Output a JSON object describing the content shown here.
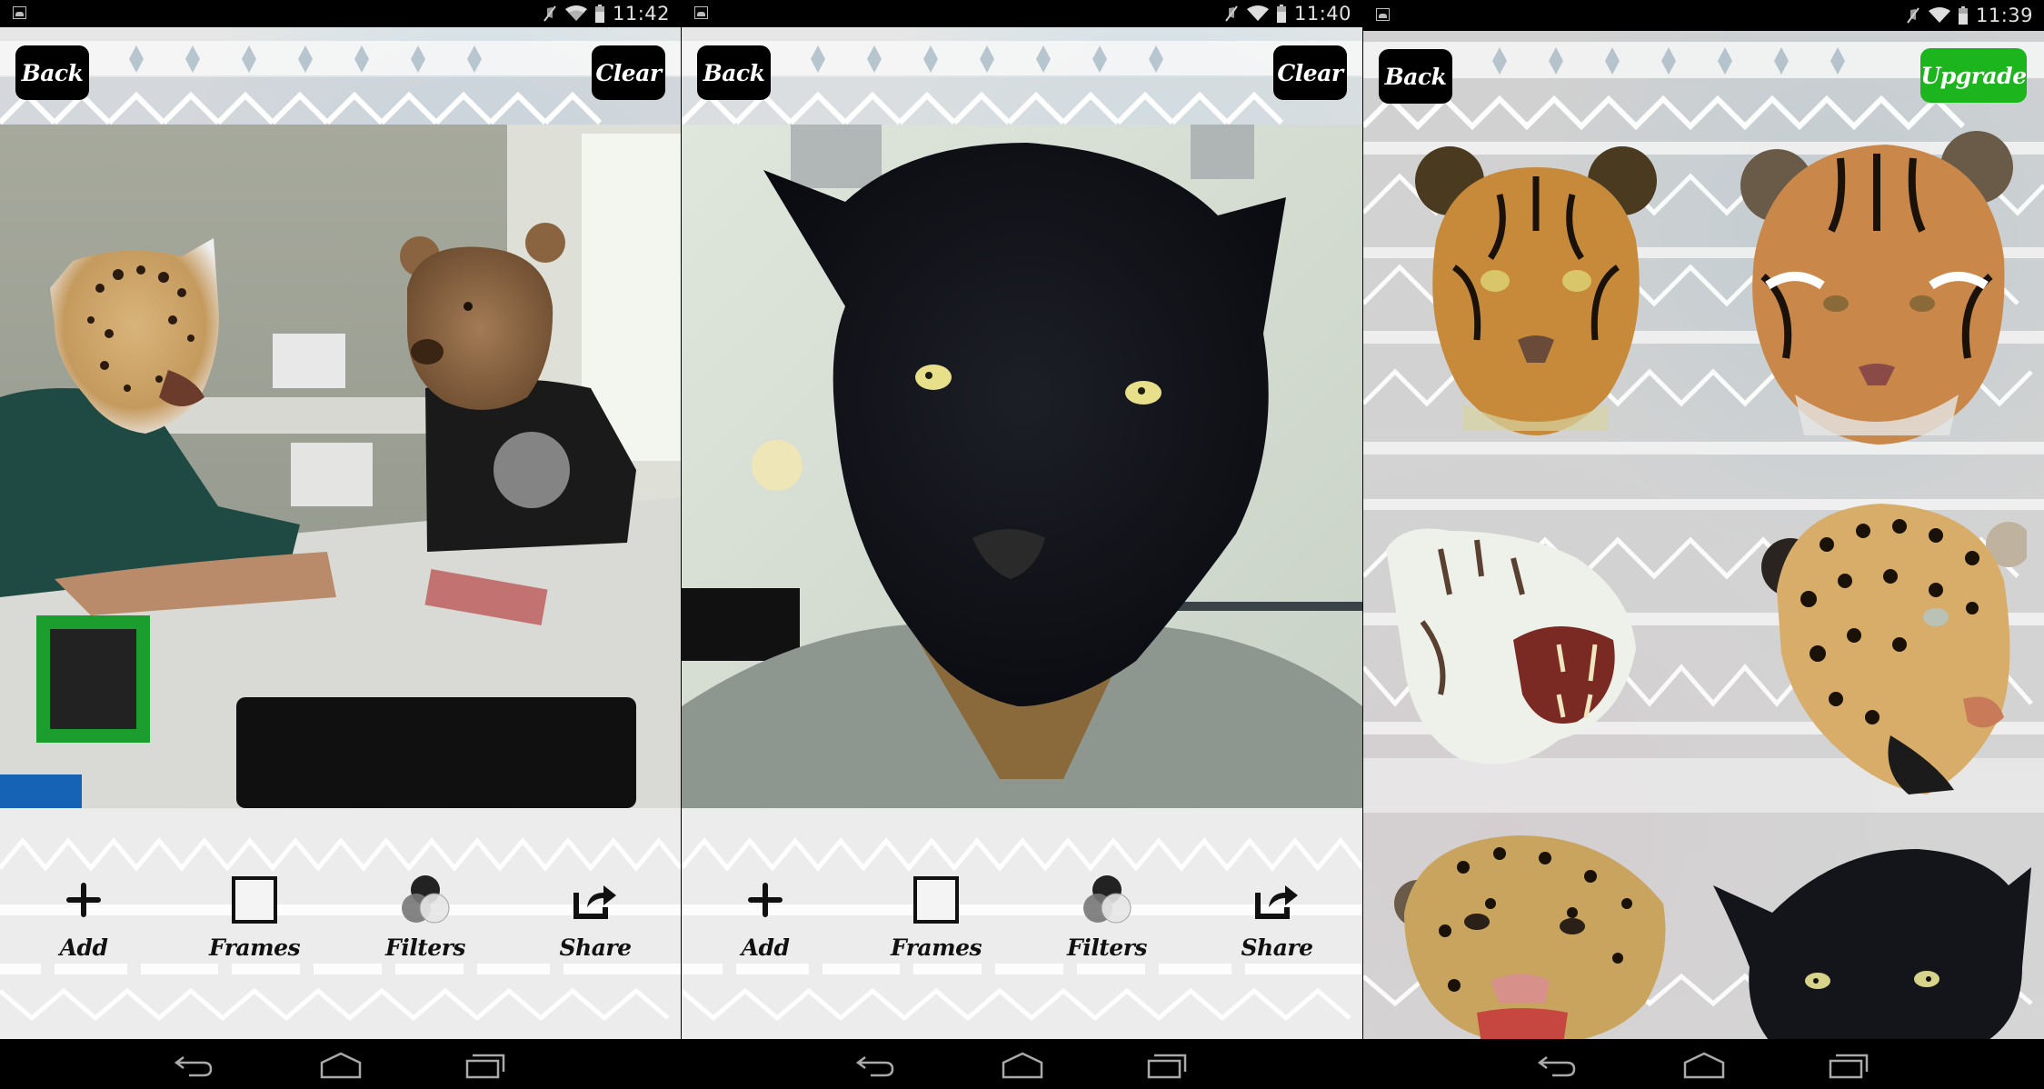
{
  "screens": [
    {
      "id": "editor-group-photo",
      "status_bar": {
        "time": "11:42",
        "icons": [
          "gallery-notification-icon",
          "mute-icon",
          "wifi-icon",
          "battery-icon"
        ]
      },
      "header": {
        "left_button": "Back",
        "right_button": "Clear"
      },
      "photo": {
        "description": "Office photo with two people wearing jaguar and bear head overlays",
        "stickers": [
          "jaguar",
          "bear"
        ]
      },
      "toolbar": [
        {
          "label": "Add",
          "icon": "plus-icon"
        },
        {
          "label": "Frames",
          "icon": "frame-icon"
        },
        {
          "label": "Filters",
          "icon": "filters-icon"
        },
        {
          "label": "Share",
          "icon": "share-icon"
        }
      ]
    },
    {
      "id": "editor-selfie",
      "status_bar": {
        "time": "11:40",
        "icons": [
          "gallery-notification-icon",
          "mute-icon",
          "wifi-icon",
          "battery-icon"
        ]
      },
      "header": {
        "left_button": "Back",
        "right_button": "Clear"
      },
      "photo": {
        "description": "Selfie with black panther head overlay",
        "stickers": [
          "black-panther"
        ]
      },
      "toolbar": [
        {
          "label": "Add",
          "icon": "plus-icon"
        },
        {
          "label": "Frames",
          "icon": "frame-icon"
        },
        {
          "label": "Filters",
          "icon": "filters-icon"
        },
        {
          "label": "Share",
          "icon": "share-icon"
        }
      ]
    },
    {
      "id": "sticker-picker",
      "status_bar": {
        "time": "11:39",
        "icons": [
          "gallery-notification-icon",
          "mute-icon",
          "wifi-icon",
          "battery-icon"
        ]
      },
      "header": {
        "left_button": "Back",
        "right_button": "Upgrade"
      },
      "stickers": [
        {
          "name": "bengal-tiger"
        },
        {
          "name": "siberian-tiger"
        },
        {
          "name": "white-tiger-roaring"
        },
        {
          "name": "jaguar-snarling"
        },
        {
          "name": "leopard-roaring"
        },
        {
          "name": "black-panther"
        }
      ]
    }
  ],
  "nav_bar": {
    "buttons": [
      "back",
      "home",
      "recent-apps"
    ]
  },
  "colors": {
    "upgrade_green": "#1db51d",
    "button_black": "#000000",
    "status_bar": "#000000"
  }
}
